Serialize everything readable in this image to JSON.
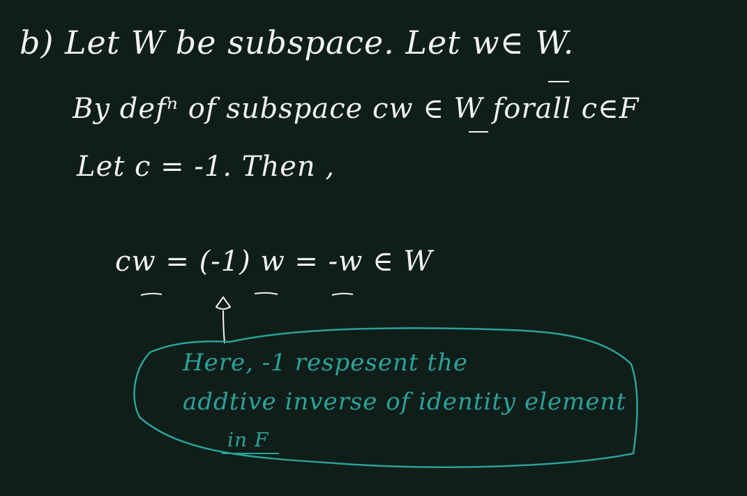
{
  "page": {
    "background": "#0f1e19",
    "ink_color": "#f2f2f2",
    "annotation_color": "#2aa39a"
  },
  "proof": {
    "line1": "b) Let W be subspace. Let w∈ W.",
    "line2": "By defⁿ of subspace  cw ∈ W forall c∈F",
    "line3": "Let c = -1. Then ,",
    "equation": "cw = (-1) w = -w ∈ W"
  },
  "note": {
    "line1": "Here, -1 respesent the",
    "line2": "addtive inverse of identity element",
    "line3": "in F"
  }
}
